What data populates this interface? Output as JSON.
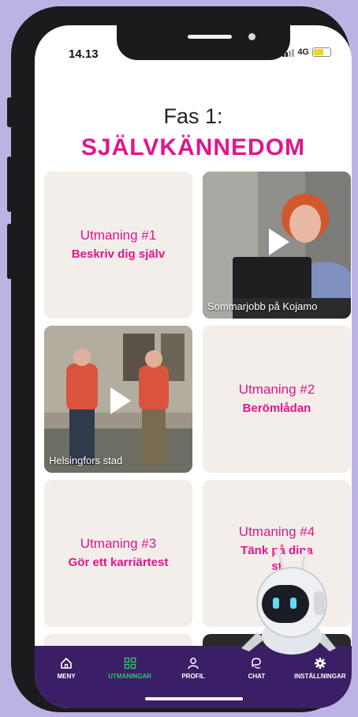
{
  "status": {
    "time": "14.13",
    "network": "4G"
  },
  "phase": {
    "label": "Fas 1:",
    "title": "SJÄLVKÄNNEDOM"
  },
  "tiles": {
    "c1": {
      "number": "Utmaning #1",
      "title": "Beskriv dig själv"
    },
    "v1": {
      "caption": "Sommarjobb på Kojamo"
    },
    "v2": {
      "caption": "Helsingfors stad"
    },
    "c2": {
      "number": "Utmaning #2",
      "title": "Berömlådan"
    },
    "c3": {
      "number": "Utmaning #3",
      "title": "Gör ett karriärtest"
    },
    "c4": {
      "number": "Utmaning #4",
      "title": "Tänk på dina",
      "title2": "st"
    }
  },
  "tabs": [
    {
      "label": "MENY",
      "icon": "home-icon"
    },
    {
      "label": "UTMANINGAR",
      "icon": "grid-icon",
      "active": true
    },
    {
      "label": "PROFIL",
      "icon": "user-icon"
    },
    {
      "label": "CHAT",
      "icon": "chat-icon"
    },
    {
      "label": "INSTÄLLNINGAR",
      "icon": "gear-icon"
    }
  ],
  "colors": {
    "accent": "#e0168a",
    "tabbar": "#3b1f66",
    "active_tab": "#33c16b",
    "tile_bg": "#f3eee9",
    "background": "#bcb3e3"
  }
}
